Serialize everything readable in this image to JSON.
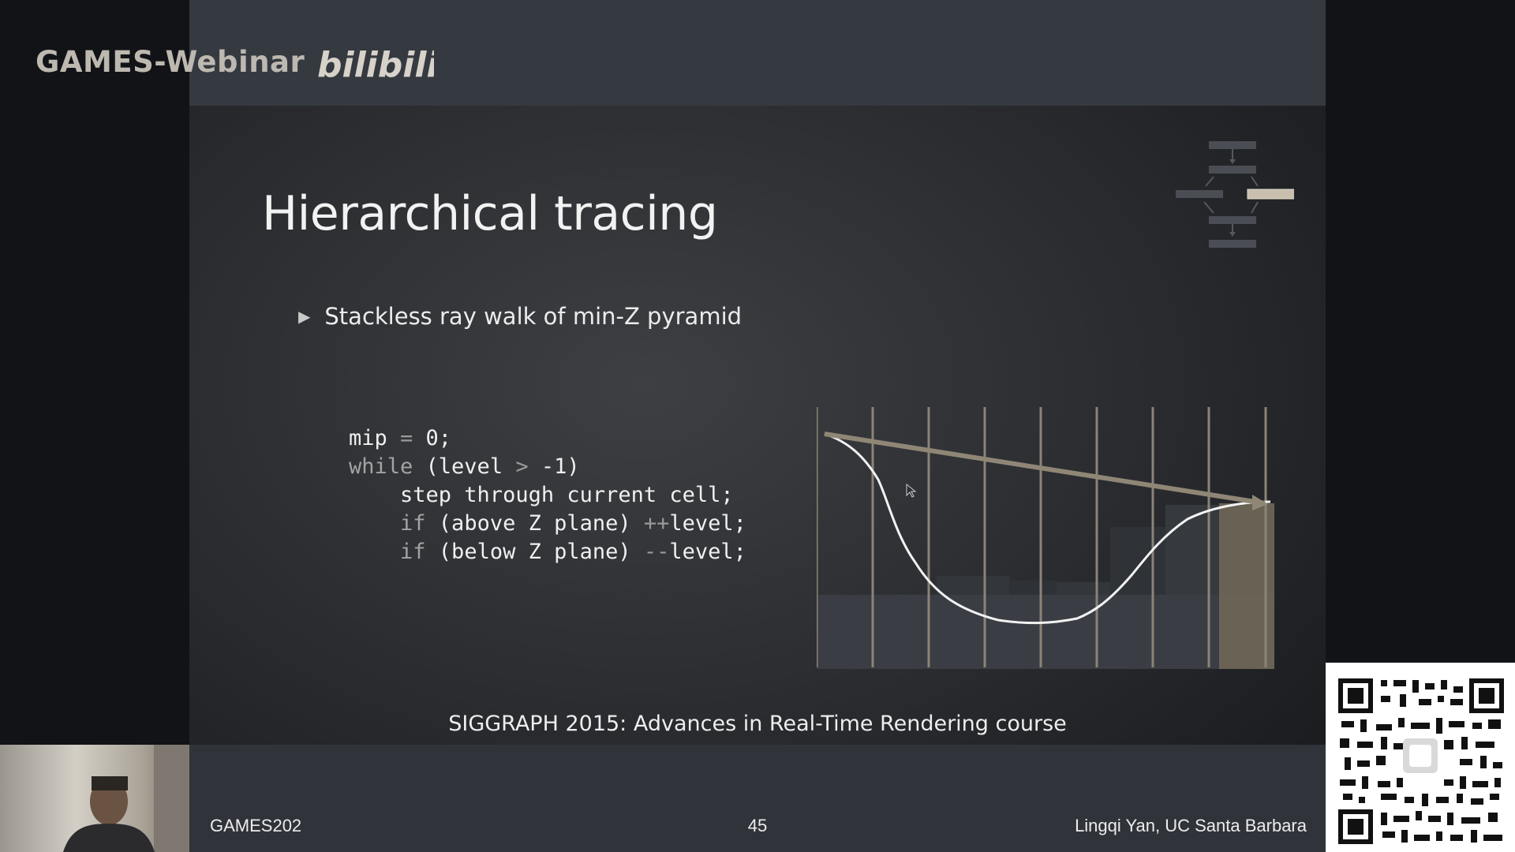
{
  "watermark": {
    "text": "GAMES-Webinar",
    "logo_text": "bilibili"
  },
  "slide": {
    "title": "Hierarchical tracing",
    "bullet": "Stackless ray walk of min-Z pyramid",
    "code": {
      "line1": {
        "a": "mip ",
        "b": "=",
        "c": " 0;"
      },
      "line2": {
        "kw": "while",
        "a": " (level ",
        "op": ">",
        "b": " -1)"
      },
      "line3": {
        "a": "    step through current cell;"
      },
      "line4": {
        "indent": "    ",
        "kw": "if",
        "a": " (above Z plane) ",
        "op": "++",
        "b": "level;"
      },
      "line5": {
        "indent": "    ",
        "kw": "if",
        "a": " (below Z plane) ",
        "op": "--",
        "b": "level;"
      }
    },
    "citation": "SIGGRAPH 2015: Advances in Real-Time Rendering course"
  },
  "footer": {
    "left": "GAMES202",
    "page": "45",
    "right": "Lingqi Yan, UC Santa Barbara"
  },
  "colors": {
    "slide_bg": "#2c2e32",
    "band": "#353a40",
    "ray": "#8f8676",
    "grid_line": "#8a8477",
    "highlight_cell": "#6d6556"
  },
  "icons": [
    "play-triangle-icon",
    "cursor-icon",
    "flowchart-icon",
    "qr-code-icon"
  ]
}
